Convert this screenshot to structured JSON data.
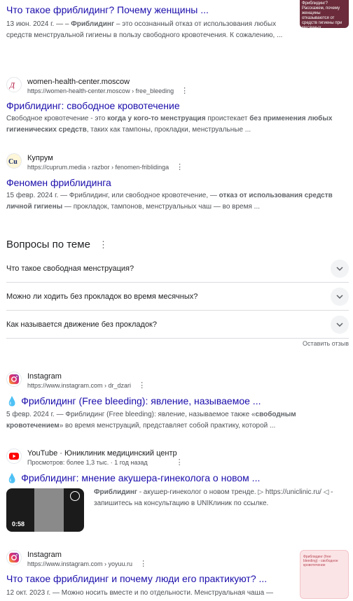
{
  "top_result": {
    "title": "Что такое фриблидинг? Почему женщины ...",
    "snippet_date": "13 июн. 2024 г. — – ",
    "snippet_bold": "Фриблидинг",
    "snippet_rest": " – это осознанный отказ от использования любых средств менструальной гигиены в пользу свободного кровотечения. К сожалению, ...",
    "thumb_text": "Фриблидинг? Расскажем, почему женщины отказываются от средств гигиены при месячных"
  },
  "result_whc": {
    "site_name": "women-health-center.moscow",
    "url": "https://women-health-center.moscow › free_bleeding",
    "title": "Фриблидинг: свободное кровотечение",
    "snippet_a": "Свободное кровотечение - это ",
    "snippet_b": "когда у кого-то менструация",
    "snippet_c": " проистекает ",
    "snippet_d": "без применения любых гигиенических средств",
    "snippet_e": ", таких как тампоны, прокладки, менструальные ..."
  },
  "result_cuprum": {
    "site_name": "Купрум",
    "url": "https://cuprum.media › razbor › fenomen-friblidinga",
    "title": "Феномен фриблидинга",
    "snippet_a": "15 февр. 2024 г. — Фриблидинг, или свободное кровотечение, — ",
    "snippet_b": "отказ от использования средств личной гигиены",
    "snippet_c": " — прокладок, тампонов, менструальных чаш — во время ..."
  },
  "paa": {
    "title": "Вопросы по теме",
    "questions": [
      "Что такое свободная менструация?",
      "Можно ли ходить без прокладок во время месячных?",
      "Как называется движение без прокладок?"
    ],
    "feedback": "Оставить отзыв"
  },
  "result_insta1": {
    "site_name": "Instagram",
    "url": "https://www.instagram.com › dr_dzari",
    "title": "Фриблидинг (Free bleeding): явление, называемое ...",
    "snippet_a": "5 февр. 2024 г. — ",
    "snippet_b": "Фриблидинг",
    "snippet_c": " (Free bleeding): явление, называемое также «",
    "snippet_d": "свободным кровотечением",
    "snippet_e": "» во время менструаций, представляет собой практику, которой ..."
  },
  "result_youtube": {
    "site_name": "YouTube · Юниклиник медицинский центр",
    "url": "Просмотров: более 1,3 тыс. · 1 год назад",
    "title": "Фриблидинг: мнение акушера-гинеколога о новом ...",
    "duration": "0:58",
    "desc_bold": "Фриблидинг",
    "desc_rest": " - акушер-гинеколог о новом тренде. ▷ https://uniclinic.ru/ ◁ - запишитесь на консультацию в UNIКлиник по ссылке."
  },
  "result_insta2": {
    "site_name": "Instagram",
    "url": "https://www.instagram.com › yoyuu.ru",
    "title": "Что такое фриблидинг и почему люди его практикуют? ...",
    "snippet": "12 окт. 2023 г. — Можно носить вместе и по отдельности. Менструальная чаша —",
    "thumb_text": "Фриблидинг (free bleeding) - свободное кровотечение"
  },
  "colors": {
    "link": "#1a0dab",
    "snippet": "#4d5156"
  }
}
